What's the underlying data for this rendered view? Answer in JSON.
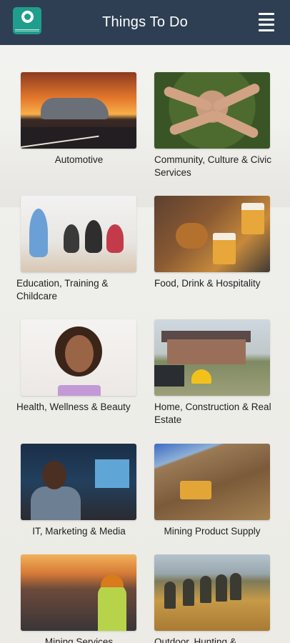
{
  "header": {
    "title": "Things To Do",
    "logo_icon": "location-pin-logo",
    "menu_icon": "hamburger-menu-icon",
    "background": "#2e3f54"
  },
  "categories": [
    {
      "label": "Automotive"
    },
    {
      "label": "Community, Culture & Civic Services"
    },
    {
      "label": "Education, Training & Childcare"
    },
    {
      "label": "Food, Drink & Hospitality"
    },
    {
      "label": "Health, Wellness & Beauty"
    },
    {
      "label": "Home, Construction & Real Estate"
    },
    {
      "label": "IT, Marketing & Media"
    },
    {
      "label": "Mining Product Supply"
    },
    {
      "label": "Mining Services"
    },
    {
      "label": "Outdoor, Hunting &"
    }
  ]
}
